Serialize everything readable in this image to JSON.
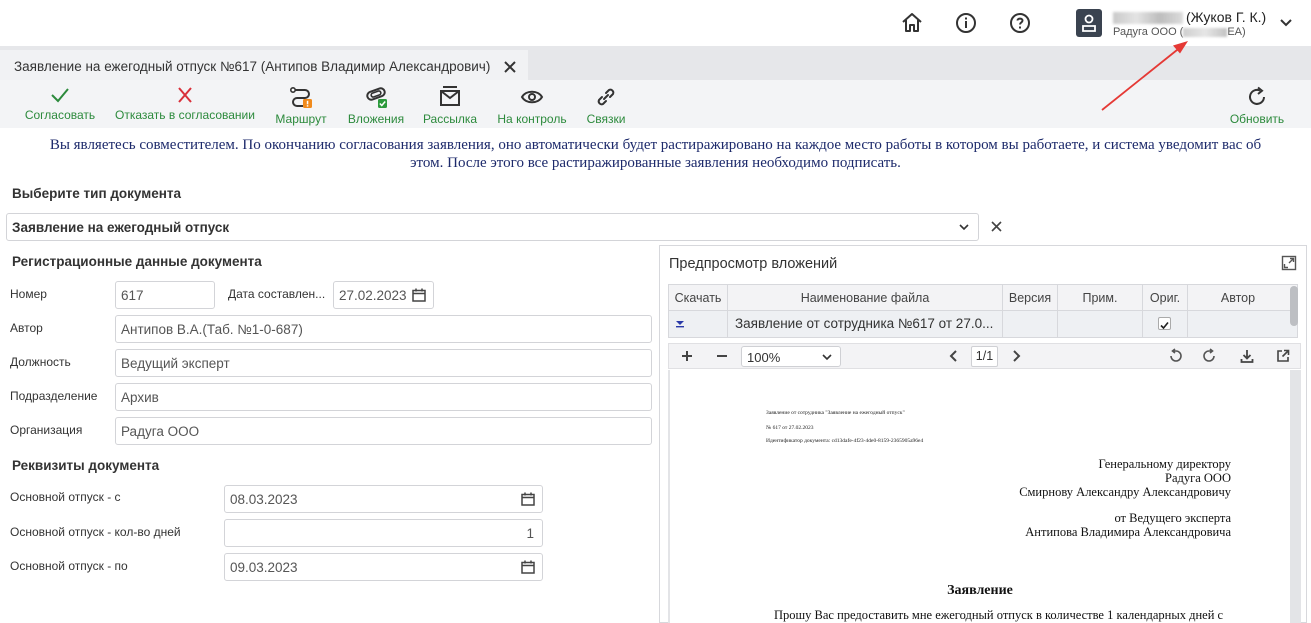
{
  "header": {
    "user_name": "(Жуков Г. К.)",
    "user_org": "Радуга ООО (",
    "user_org_suffix": "EA)"
  },
  "tab": {
    "title": "Заявление на ежегодный отпуск №617 (Антипов Владимир Александрович)"
  },
  "toolbar": {
    "approve": "Согласовать",
    "reject": "Отказать в согласовании",
    "route": "Маршрут",
    "attachments": "Вложения",
    "mailing": "Рассылка",
    "control": "На контроль",
    "links": "Связки",
    "refresh": "Обновить"
  },
  "notice": {
    "line1": "Вы являетесь совместителем. По окончанию согласования заявления, оно автоматически будет растиражировано на каждое место работы в котором вы работаете, и система уведомит вас об",
    "line2": "этом. После этого все растиражированные заявления необходимо подписать."
  },
  "doc_type": {
    "title": "Выберите тип документа",
    "value": "Заявление на ежегодный отпуск"
  },
  "registration": {
    "title": "Регистрационные данные документа",
    "number_label": "Номер",
    "number_value": "617",
    "date_label": "Дата составлен...",
    "date_value": "27.02.2023",
    "author_label": "Автор",
    "author_value": "Антипов В.А.(Таб. №1-0-687)",
    "position_label": "Должность",
    "position_value": "Ведущий эксперт",
    "department_label": "Подразделение",
    "department_value": "Архив",
    "organization_label": "Организация",
    "organization_value": "Радуга ООО"
  },
  "requisites": {
    "title": "Реквизиты документа",
    "from_label": "Основной отпуск - с",
    "from_value": "08.03.2023",
    "days_label": "Основной отпуск - кол-во дней",
    "days_value": "1",
    "to_label": "Основной отпуск - по",
    "to_value": "09.03.2023"
  },
  "preview": {
    "title": "Предпросмотр вложений",
    "columns": [
      "Скачать",
      "Наименование файла",
      "Версия",
      "Прим.",
      "Ориг.",
      "Автор"
    ],
    "row": {
      "file_name": "Заявление от сотрудника №617 от 27.0..."
    },
    "zoom": "100%",
    "page": "1/1",
    "document": {
      "meta1": "Заявление от сотрудника \"Заявление на ежегодный отпуск\"",
      "meta2": "№ 617 от 27.02.2023",
      "meta3": "Идентификатор документа: cd13dafe-4f23-4de0-8159-2365905a96e4",
      "addr1": "Генеральному директору",
      "addr2": "Радуга ООО",
      "addr3": "Смирнову Александру Александровичу",
      "from1": "от Ведущего эксперта",
      "from2": "Антипова Владимира Александровича",
      "heading": "Заявление",
      "body": "Прошу Вас предоставить мне ежегодный отпуск в количестве 1 календарных дней  с"
    }
  },
  "colors": {
    "accent_green": "#2c8a3c",
    "reject_red": "#d9303a",
    "badge_orange": "#f08a1c",
    "arrow_red": "#e53935"
  }
}
